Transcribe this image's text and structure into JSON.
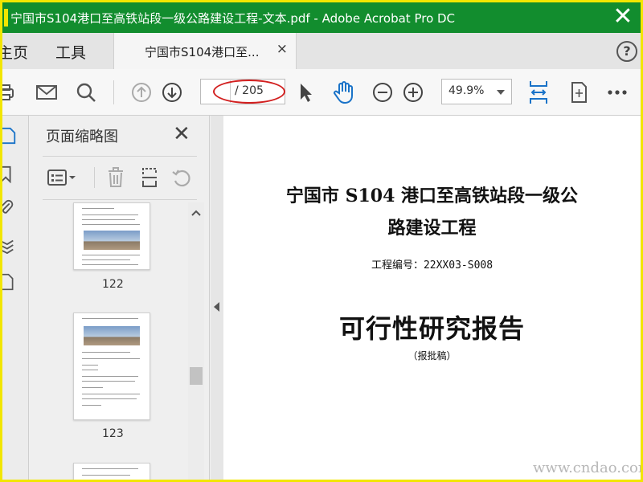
{
  "window": {
    "title": "宁国市S104港口至高铁站段一级公路建设工程-文本.pdf - Adobe Acrobat Pro DC",
    "close_glyph": "✕"
  },
  "menu": {
    "home_label": "主页",
    "tools_label": "工具",
    "tab_label": "宁国市S104港口至...",
    "tab_close": "×",
    "help_glyph": "?"
  },
  "toolbar": {
    "page_current": "",
    "page_total": "/ 205",
    "zoom_value": "49.9%"
  },
  "sidebar": {
    "title": "页面缩略图",
    "close_glyph": "✕",
    "thumbnails": [
      {
        "page_number": "122"
      },
      {
        "page_number": "123"
      }
    ]
  },
  "document": {
    "title_line1": "宁国市 S104 港口至高铁站段一级公",
    "title_line2": "路建设工程",
    "project_number": "工程编号：22XX03-S008",
    "report_title": "可行性研究报告",
    "report_subtitle": "（报批稿）"
  },
  "watermark": {
    "text": "www.cndao.com"
  },
  "colors": {
    "titlebar_bg": "#128d2e",
    "accent_blue": "#1a73c8",
    "highlight_oval": "#d21f1f",
    "border_yellow": "#f2e600"
  }
}
